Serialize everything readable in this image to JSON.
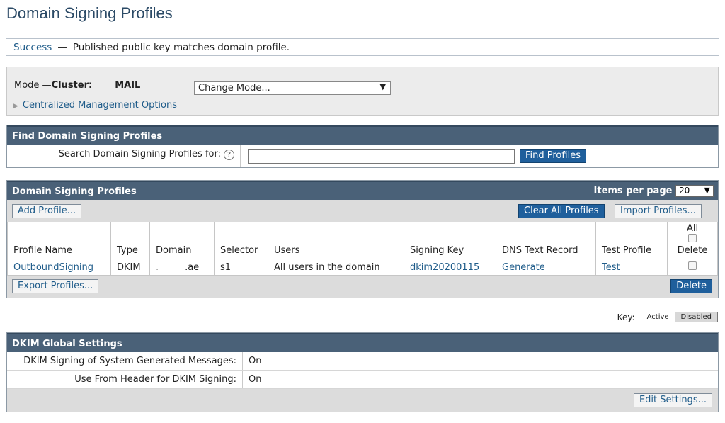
{
  "page": {
    "title": "Domain Signing Profiles"
  },
  "notice": {
    "status": "Success",
    "separator": "—",
    "message": "Published public key matches domain profile."
  },
  "mode": {
    "label": "Mode —",
    "cluster_label": "Cluster:",
    "cluster_name": "MAIL",
    "change_mode_value": "Change Mode...",
    "centralized_link": "Centralized Management Options"
  },
  "find": {
    "header": "Find Domain Signing Profiles",
    "search_label": "Search Domain Signing Profiles for:",
    "help_icon": "?",
    "search_value": "",
    "button": "Find Profiles"
  },
  "profiles": {
    "header": "Domain Signing Profiles",
    "items_per_page_label": "Items per page",
    "items_per_page_value": "20",
    "add_button": "Add Profile...",
    "clear_button": "Clear All Profiles",
    "import_button": "Import Profiles...",
    "export_button": "Export Profiles...",
    "delete_button": "Delete",
    "columns": {
      "name": "Profile Name",
      "type": "Type",
      "domain": "Domain",
      "selector": "Selector",
      "users": "Users",
      "signing_key": "Signing Key",
      "dns_record": "DNS Text Record",
      "test_profile": "Test Profile",
      "all": "All",
      "delete": "Delete"
    },
    "rows": [
      {
        "name": "OutboundSigning",
        "type": "DKIM",
        "domain": ".ae",
        "selector": "s1",
        "users": "All users in the domain",
        "signing_key": "dkim20200115",
        "dns_record": "Generate",
        "test_profile": "Test"
      }
    ]
  },
  "key": {
    "label": "Key:",
    "active": "Active",
    "disabled": "Disabled"
  },
  "dkim": {
    "header": "DKIM Global Settings",
    "rows": [
      {
        "label": "DKIM Signing of System Generated Messages:",
        "value": "On"
      },
      {
        "label": "Use From Header for DKIM Signing:",
        "value": "On"
      }
    ],
    "edit_button": "Edit Settings..."
  },
  "colors": {
    "panel_header": "#4a6178",
    "primary_button": "#1f5f9c",
    "link": "#1f5c8a",
    "title": "#2b4a66"
  }
}
